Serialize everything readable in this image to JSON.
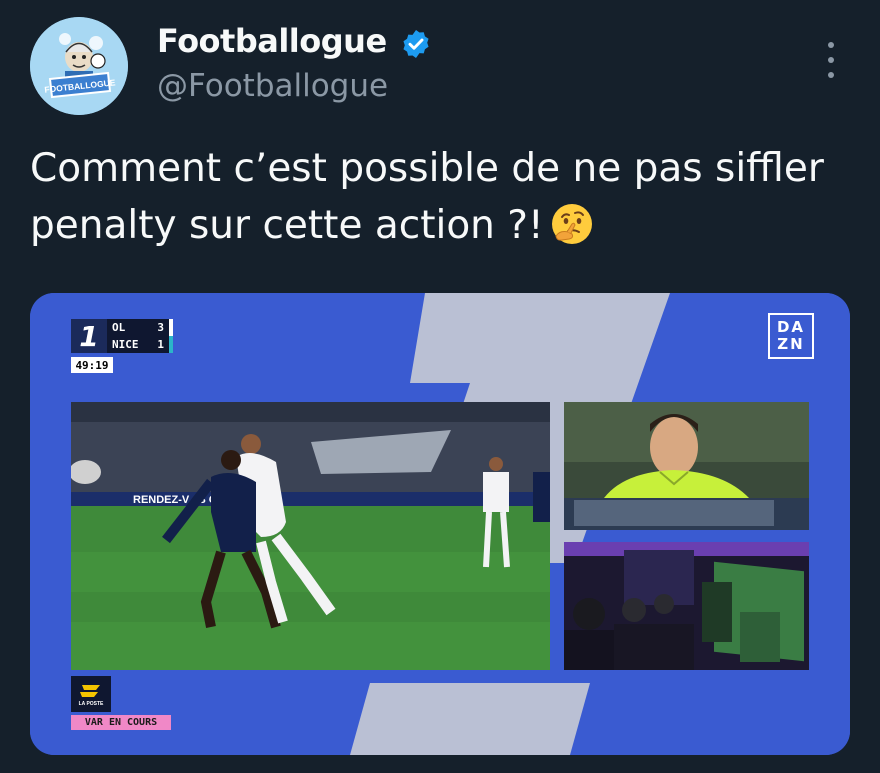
{
  "account": {
    "display_name": "Footballogue",
    "handle": "@Footballogue",
    "avatar_text": "FOOTBALLOGUE",
    "verified": true
  },
  "tweet": {
    "text": "Comment c’est possible de ne pas siffler penalty sur cette action ?!",
    "emoji": "thinking-face"
  },
  "media": {
    "scoreboard": {
      "league_logo": "1",
      "home_team": "OL",
      "home_score": "3",
      "away_team": "NICE",
      "away_score": "1",
      "clock": "49:19"
    },
    "broadcaster": [
      "DA",
      "ZN"
    ],
    "sponsor_label": "LA POSTE",
    "var_label": "VAR EN COURS",
    "ad_board_text": "RENDEZ-V    JS        OR.FR",
    "colors": {
      "background": "#3a5bd1",
      "pitch": "#3f8a3a",
      "referee_shirt": "#c7f03a",
      "var_badge": "#f088c7"
    }
  },
  "icons": {
    "verified": "verified-badge-icon",
    "more": "more-options-icon"
  }
}
